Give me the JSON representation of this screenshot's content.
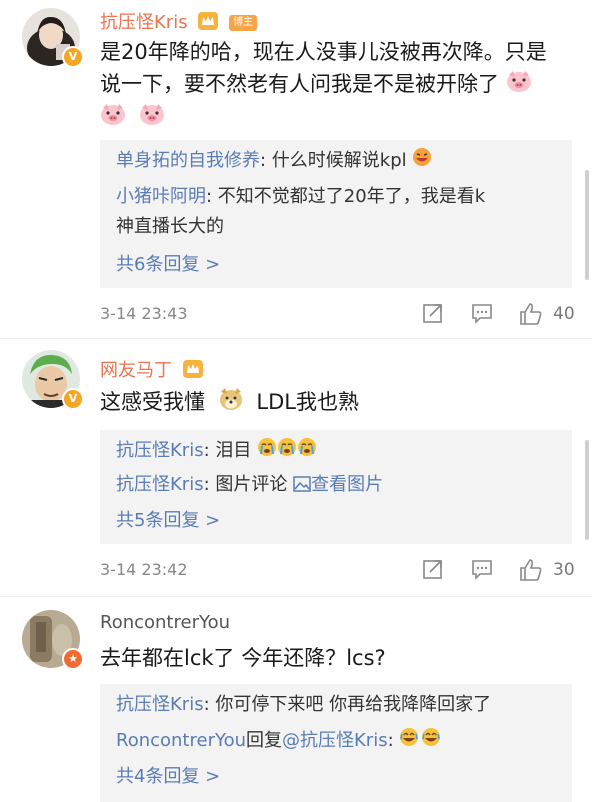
{
  "comments": [
    {
      "user": "抗压怪Kris",
      "host_tag": "博主",
      "text_line1": "是20年降的哈，现在人没事儿没被再次降。只是",
      "text_line2": "说一下，要不然老有人问我是不是被开除了",
      "replies": [
        {
          "name": "单身拓的自我修养",
          "text": ": 什么时候解说kpl"
        },
        {
          "name": "小猪咔阿明",
          "text": ": 不知不觉都过了20年了，我是看k",
          "cont": "神直播长大的"
        }
      ],
      "more": "共6条回复 >",
      "time": "3-14 23:43",
      "likes": "40"
    },
    {
      "user": "网友马丁",
      "text": "这感受我懂",
      "text_tail": "LDL我也熟",
      "replies": [
        {
          "name": "抗压怪Kris",
          "text": ": 泪目"
        },
        {
          "name": "抗压怪Kris",
          "text": ": 图片评论",
          "link": "查看图片"
        }
      ],
      "more": "共5条回复 >",
      "time": "3-14 23:42",
      "likes": "30"
    },
    {
      "user": "RoncontrerYou",
      "text": "去年都在lck了 今年还降？lcs?",
      "replies": [
        {
          "name": "抗压怪Kris",
          "text": ": 你可停下来吧 你再给我降降回家了"
        },
        {
          "name": "RoncontrerYou",
          "text": "回复",
          "mention": "@抗压怪Kris",
          "tail": ":"
        }
      ],
      "more": "共4条回复 >"
    }
  ],
  "icons": [
    "verified-badge-icon",
    "crown-icon",
    "pig-emoji-icon",
    "doge-emoji-icon",
    "cry-emoji-icon",
    "laugh-emoji-icon",
    "forward-icon",
    "comment-icon",
    "like-icon",
    "image-icon"
  ],
  "colors": {
    "username": "#eb7350",
    "reply_name": "#5a7cb5",
    "reply_bg": "#f3f3f3",
    "verified": "#f5a623",
    "orange_badge": "#ef6b32"
  }
}
